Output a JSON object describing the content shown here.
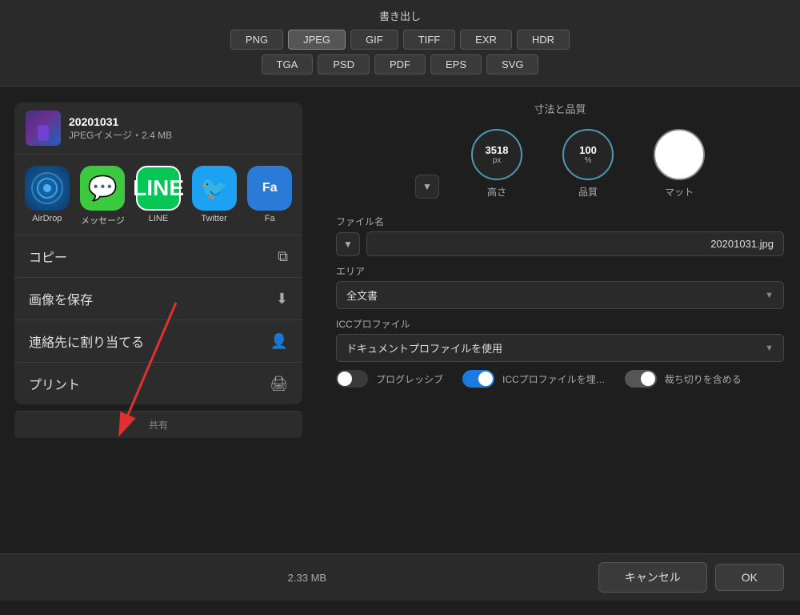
{
  "exportBar": {
    "title": "書き出し",
    "formats": [
      "PNG",
      "JPEG",
      "GIF",
      "TIFF",
      "EXR",
      "HDR",
      "TGA",
      "PSD",
      "PDF",
      "EPS",
      "SVG"
    ],
    "activeFormat": "JPEG"
  },
  "fileInfo": {
    "name": "20201031",
    "type": "JPEGイメージ・2.4 MB"
  },
  "apps": [
    {
      "id": "airdrop",
      "label": "AirDrop"
    },
    {
      "id": "messages",
      "label": "メッセージ"
    },
    {
      "id": "line",
      "label": "LINE"
    },
    {
      "id": "twitter",
      "label": "Twitter"
    },
    {
      "id": "partial",
      "label": "Fa"
    }
  ],
  "shareActions": [
    {
      "id": "copy",
      "label": "コピー",
      "icon": "⧉"
    },
    {
      "id": "saveImage",
      "label": "画像を保存",
      "icon": "⬇"
    },
    {
      "id": "assignContact",
      "label": "連絡先に割り当てる",
      "icon": "👤"
    },
    {
      "id": "print",
      "label": "プリント",
      "icon": "🖨"
    }
  ],
  "shareFooter": "共有",
  "rightPanel": {
    "sectionTitle": "寸法と品質",
    "height": {
      "value": "3518",
      "unit": "px",
      "label": "高さ"
    },
    "quality": {
      "value": "100",
      "unit": "%",
      "label": "品質"
    },
    "matte": {
      "label": "マット"
    },
    "filename": {
      "label": "ファイル名",
      "value": "20201031.jpg"
    },
    "area": {
      "label": "エリア",
      "value": "全文書"
    },
    "iccProfile": {
      "label": "ICCプロファイル",
      "value": "ドキュメントプロファイルを使用"
    },
    "progressive": {
      "label": "プログレッシブ"
    },
    "embedICC": {
      "label": "ICCプロファイルを埋…"
    },
    "includeCrop": {
      "label": "裁ち切りを含める"
    },
    "fileSizeBottom": "2.33 MB"
  },
  "bottomBar": {
    "cancel": "キャンセル",
    "ok": "OK"
  }
}
